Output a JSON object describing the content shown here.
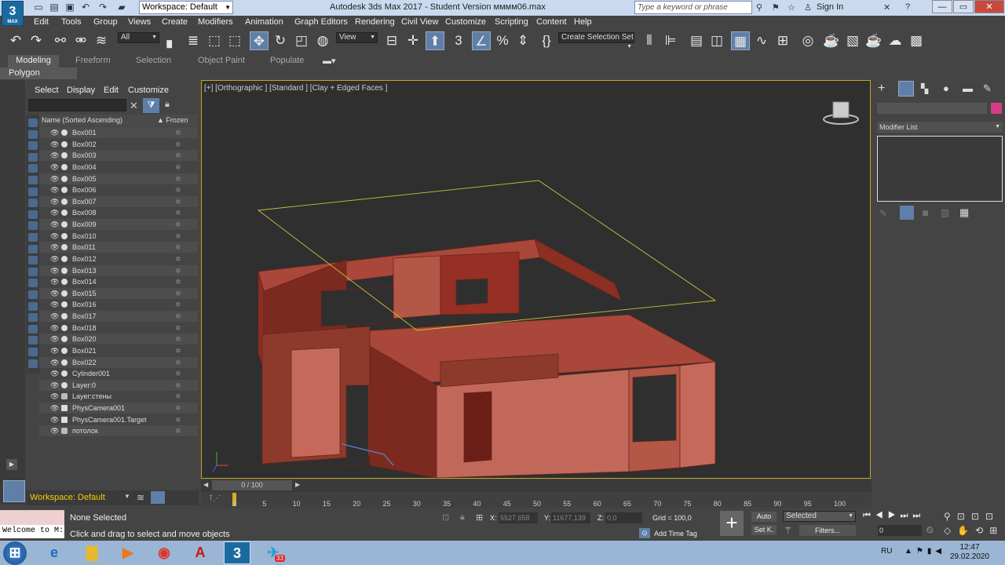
{
  "titlebar": {
    "app_logo": "3",
    "app_logo_sub": "MAX",
    "workspace": "Workspace: Default",
    "title": "Autodesk 3ds Max 2017 - Student Version      мммм06.max",
    "search_placeholder": "Type a keyword or phrase",
    "sign_in": "Sign In",
    "minimize": "—",
    "restore": "▭",
    "close": "✕"
  },
  "menu": [
    "Edit",
    "Tools",
    "Group",
    "Views",
    "Create",
    "Modifiers",
    "Animation",
    "Graph Editors",
    "Rendering",
    "Civil View",
    "Customize",
    "Scripting",
    "Content",
    "Help"
  ],
  "toolbar": {
    "filter": "All",
    "view": "View",
    "create_selection_set": "Create Selection Set"
  },
  "ribbon": {
    "tabs": [
      "Modeling",
      "Freeform",
      "Selection",
      "Object Paint",
      "Populate"
    ],
    "subtab": "Polygon Modeling"
  },
  "scene_explorer": {
    "tabs": [
      "Select",
      "Display",
      "Edit",
      "Customize"
    ],
    "header_name": "Name (Sorted Ascending)",
    "header_frozen": "▲ Frozen",
    "items": [
      {
        "name": "Box001",
        "type": "geo"
      },
      {
        "name": "Box002",
        "type": "geo"
      },
      {
        "name": "Box003",
        "type": "geo"
      },
      {
        "name": "Box004",
        "type": "geo"
      },
      {
        "name": "Box005",
        "type": "geo"
      },
      {
        "name": "Box006",
        "type": "geo"
      },
      {
        "name": "Box007",
        "type": "geo"
      },
      {
        "name": "Box008",
        "type": "geo"
      },
      {
        "name": "Box009",
        "type": "geo"
      },
      {
        "name": "Box010",
        "type": "geo"
      },
      {
        "name": "Box011",
        "type": "geo"
      },
      {
        "name": "Box012",
        "type": "geo"
      },
      {
        "name": "Box013",
        "type": "geo"
      },
      {
        "name": "Box014",
        "type": "geo"
      },
      {
        "name": "Box015",
        "type": "geo"
      },
      {
        "name": "Box016",
        "type": "geo"
      },
      {
        "name": "Box017",
        "type": "geo"
      },
      {
        "name": "Box018",
        "type": "geo"
      },
      {
        "name": "Box020",
        "type": "geo"
      },
      {
        "name": "Box021",
        "type": "geo"
      },
      {
        "name": "Box022",
        "type": "geo"
      },
      {
        "name": "Cylinder001",
        "type": "geo"
      },
      {
        "name": "Layer:0",
        "type": "geo"
      },
      {
        "name": "Layer:стены",
        "type": "layer"
      },
      {
        "name": "PhysCamera001",
        "type": "cam"
      },
      {
        "name": "PhysCamera001.Target",
        "type": "cam"
      },
      {
        "name": "потолок",
        "type": "layer"
      }
    ],
    "workspace": "Workspace: Default"
  },
  "viewport": {
    "label": "[+] [Orthographic ] [Standard ] [Clay + Edged Faces ]"
  },
  "command_panel": {
    "modifier_list": "Modifier List",
    "object_color": "#d43c8a"
  },
  "timeline": {
    "slider": "0 / 100",
    "current_frame": 0,
    "ticks": [
      "0",
      "5",
      "10",
      "15",
      "20",
      "25",
      "30",
      "35",
      "40",
      "45",
      "50",
      "55",
      "60",
      "65",
      "70",
      "75",
      "80",
      "85",
      "90",
      "95",
      "100"
    ]
  },
  "status": {
    "maxscript_welcome": "Welcome to M:",
    "selection": "None Selected",
    "prompt": "Click and drag to select and move objects",
    "x_label": "X:",
    "x_value": "5527,658",
    "y_label": "Y:",
    "y_value": "11677,139",
    "z_label": "Z:",
    "z_value": "0,0",
    "grid": "Grid = 100,0",
    "add_time_tag": "Add Time Tag",
    "auto": "Auto",
    "set_key": "Set K.",
    "selected": "Selected",
    "filters": "Filters...",
    "frame": "0"
  },
  "taskbar": {
    "lang": "RU",
    "time": "12:47",
    "date": "29.02.2020",
    "badge": "33"
  }
}
